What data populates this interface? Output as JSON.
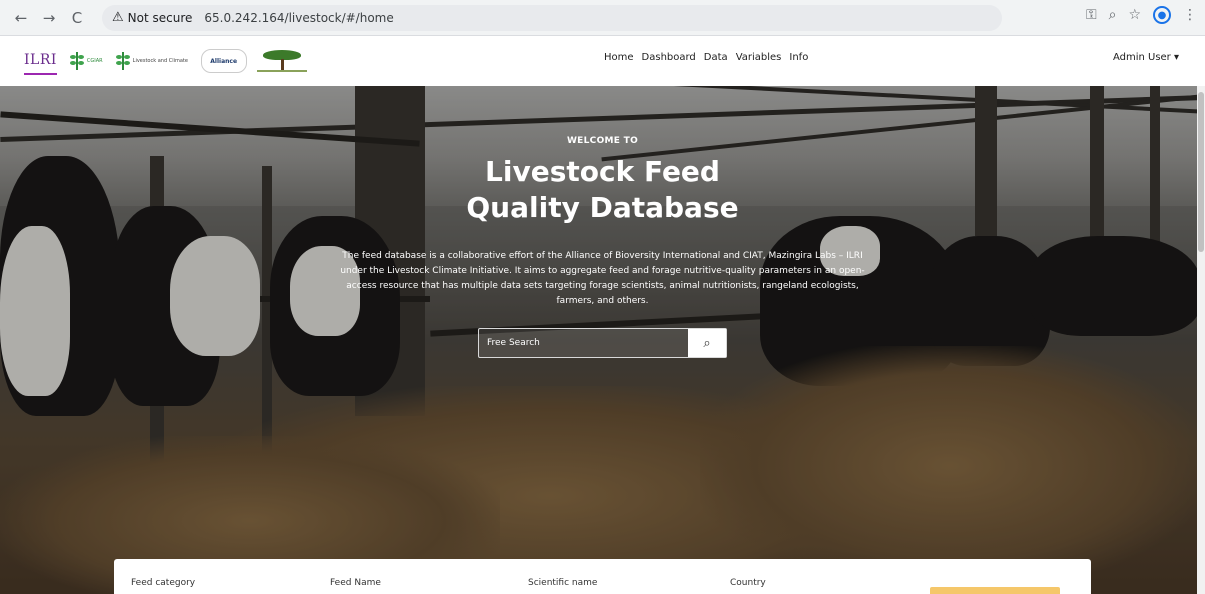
{
  "browser": {
    "back_icon": "←",
    "forward_icon": "→",
    "reload_icon": "C",
    "security_label": "Not secure",
    "url": "65.0.242.164/livestock/#/home",
    "icons": [
      "key-icon",
      "zoom-icon",
      "star-icon",
      "profile-icon",
      "menu-icon"
    ]
  },
  "header": {
    "logo_ilri": "ILRI",
    "logo_cgiar_1": "CGIAR",
    "logo_cgiar_2": "CGIAR",
    "logo_lci": "Livestock and Climate",
    "logo_alliance": "Alliance",
    "nav": [
      "Home",
      "Dashboard",
      "Data",
      "Variables",
      "Info"
    ],
    "admin_label": "Admin User ▾"
  },
  "hero": {
    "welcome": "WELCOME TO",
    "title_line1": "Livestock Feed",
    "title_line2": "Quality Database",
    "intro": "The feed database is a collaborative effort of the Alliance of Bioversity International and CIAT, Mazingira Labs – ILRI under the Livestock Climate Initiative. It aims to aggregate feed and forage nutritive-quality parameters in an open-access resource that has multiple data sets targeting forage scientists, animal nutritionists, rangeland ecologists, farmers, and others.",
    "search_placeholder": "Free Search"
  },
  "filters": {
    "labels": [
      "Feed category",
      "Feed Name",
      "Scientific name",
      "Country"
    ]
  }
}
